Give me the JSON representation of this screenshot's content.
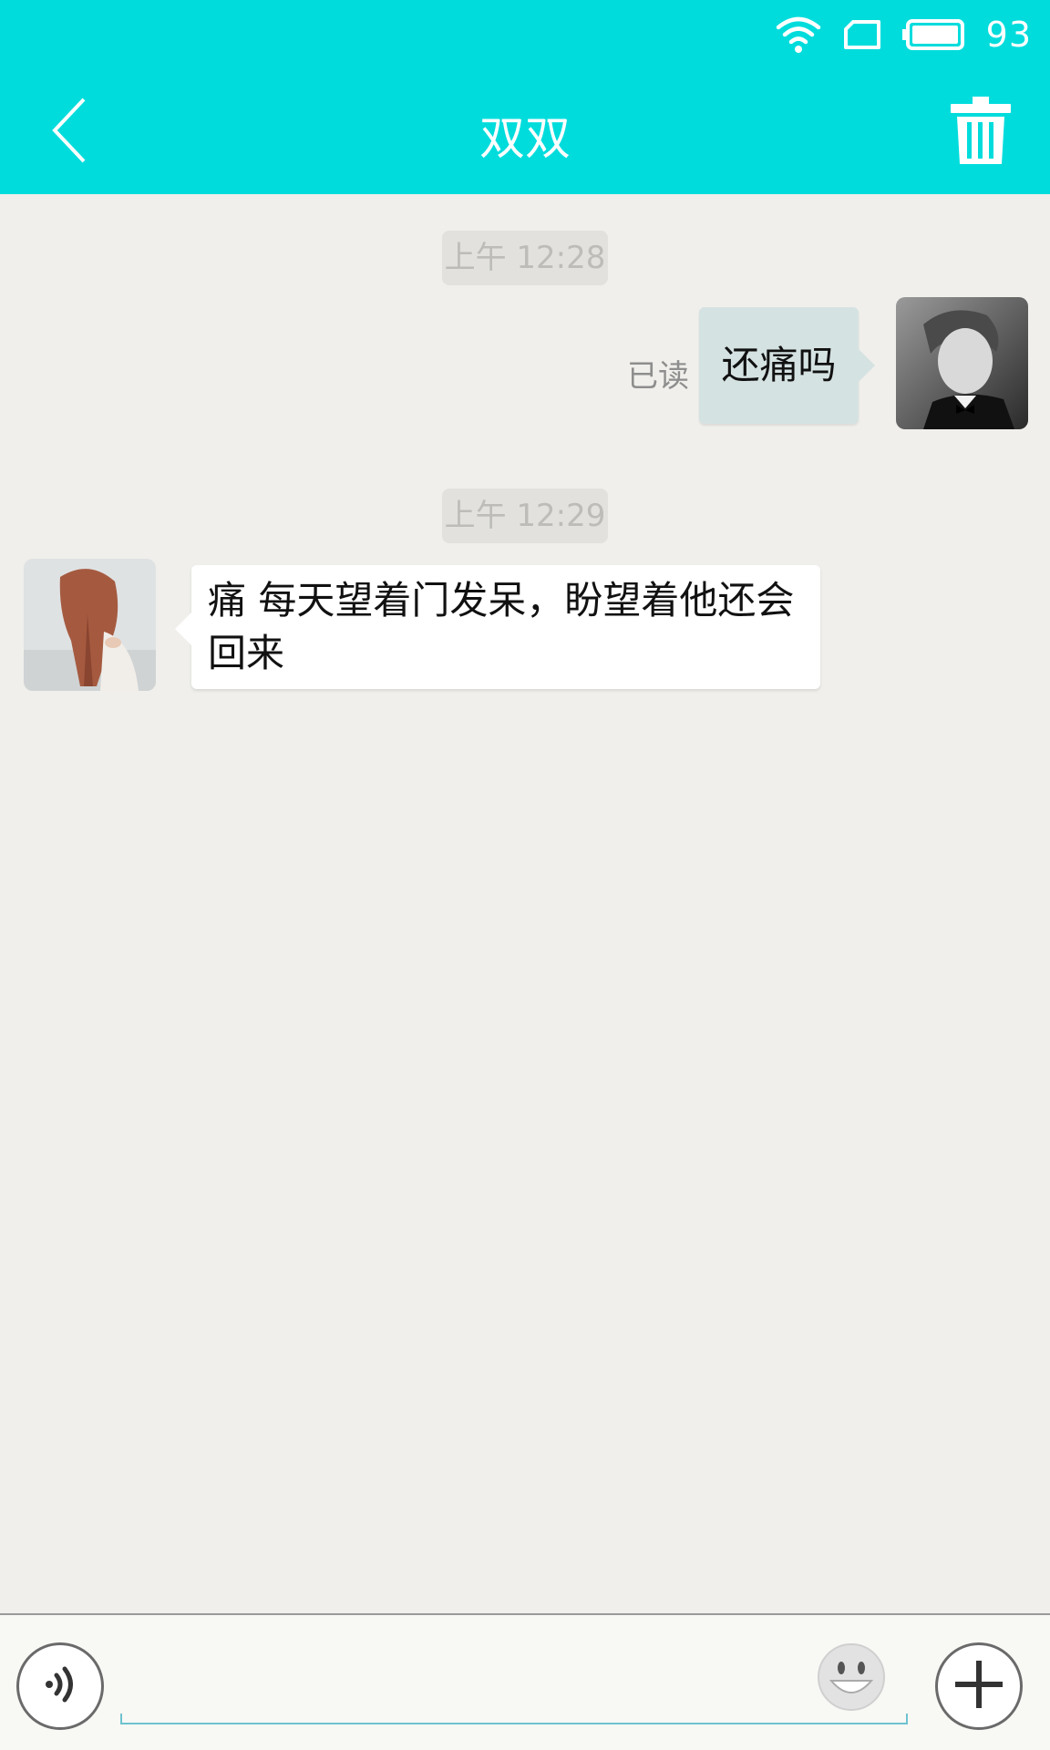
{
  "status_bar": {
    "battery_level": "93",
    "icons": [
      "wifi-icon",
      "sim-card-icon",
      "battery-icon"
    ]
  },
  "header": {
    "title": "双双",
    "back_icon": "chevron-left-icon",
    "delete_icon": "trash-icon"
  },
  "messages": [
    {
      "timestamp": "上午 12:28",
      "direction": "sent",
      "text": "还痛吗",
      "read_status": "已读",
      "avatar": "male-portrait"
    },
    {
      "timestamp": "上午 12:29",
      "direction": "received",
      "text": "痛 每天望着门发呆，盼望着他还会回来",
      "avatar": "female-portrait"
    }
  ],
  "input_bar": {
    "value": "",
    "voice_icon": "voice-icon",
    "emoji_icon": "emoji-icon",
    "plus_icon": "plus-icon"
  },
  "colors": {
    "header": "#00dcdc",
    "background": "#f0efeb",
    "sent_bubble": "#d5e2e2",
    "received_bubble": "#ffffff",
    "input_underline": "#6ec3cf"
  }
}
